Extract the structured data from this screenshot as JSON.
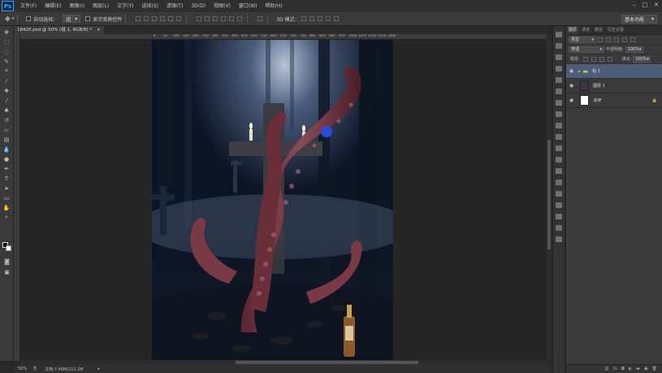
{
  "app": {
    "logo": "Ps"
  },
  "menu": [
    "文件(F)",
    "编辑(E)",
    "图像(I)",
    "图层(L)",
    "文字(Y)",
    "选择(S)",
    "滤镜(T)",
    "3D(D)",
    "视图(V)",
    "窗口(W)",
    "帮助(H)"
  ],
  "window_controls": [
    "–",
    "□",
    "✕"
  ],
  "options": {
    "auto_select_label": "自动选择：",
    "auto_select_value": "组",
    "show_transform_label": "显示变换控件",
    "mode_3d_label": "3D 模式：",
    "workspace": "基本功能"
  },
  "document": {
    "tab_title": "18420.psd @ 50% (组 1, RGB/8) *",
    "zoom": "50%",
    "doc_info": "文档:7.48M/212.2M"
  },
  "ruler": [
    "0",
    "50",
    "100",
    "150",
    "200",
    "250",
    "300",
    "350",
    "400",
    "450",
    "500",
    "550",
    "600",
    "650",
    "700",
    "750",
    "800",
    "850",
    "900",
    "950",
    "1000",
    "1050",
    "1100",
    "1150",
    "1200"
  ],
  "layers_panel": {
    "tabs": [
      "图层",
      "通道",
      "路径",
      "历史记录"
    ],
    "active_tab": "图层",
    "kind_filter": "类型",
    "blend_mode": "穿透",
    "opacity_label": "不透明度:",
    "opacity_value": "100%",
    "lock_label": "锁定:",
    "fill_label": "填充:",
    "fill_value": "100%",
    "layers": [
      {
        "name": "组 1",
        "type": "group",
        "selected": true
      },
      {
        "name": "图层 1",
        "type": "layer",
        "selected": false
      },
      {
        "name": "背景",
        "type": "background",
        "selected": false
      }
    ],
    "footer_icons": [
      "link-icon",
      "fx-icon",
      "mask-icon",
      "adjustment-icon",
      "folder-icon",
      "new-layer-icon",
      "trash-icon"
    ]
  },
  "colors": {
    "ui_dark": "#282828",
    "panel": "#3a3a3a",
    "selected_layer": "#4d5f78",
    "accent": "#31a8ff"
  }
}
